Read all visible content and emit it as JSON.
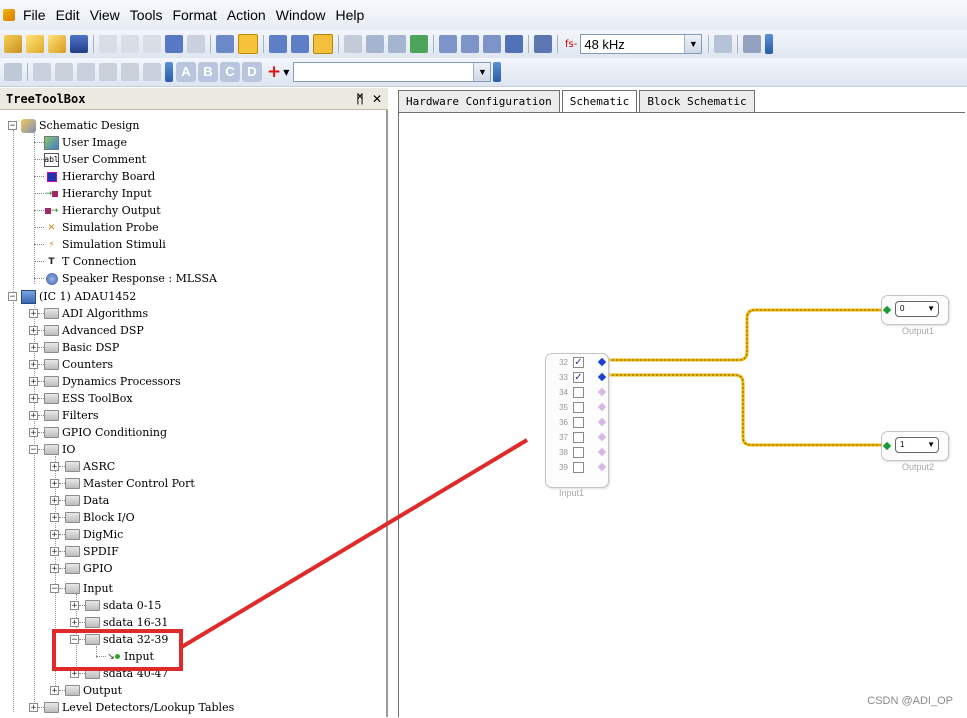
{
  "menu": [
    "File",
    "Edit",
    "View",
    "Tools",
    "Format",
    "Action",
    "Window",
    "Help"
  ],
  "toolbar": {
    "sample_rate": "48 kHz",
    "fs_label": "fs-",
    "cell_letters": [
      "A",
      "B",
      "C",
      "D"
    ],
    "add_symbol": "+"
  },
  "toolbox": {
    "title": "TreeToolBox",
    "pin": "q",
    "close": "✕"
  },
  "tree": {
    "schematic_design": "Schematic Design",
    "user_image": "User Image",
    "user_comment": "User Comment",
    "hierarchy_board": "Hierarchy Board",
    "hierarchy_input": "Hierarchy Input",
    "hierarchy_output": "Hierarchy Output",
    "simulation_probe": "Simulation Probe",
    "simulation_stimuli": "Simulation Stimuli",
    "t_connection": "T Connection",
    "speaker_response": "Speaker Response : MLSSA",
    "ic": "(IC 1) ADAU1452",
    "adi_algorithms": "ADI Algorithms",
    "advanced_dsp": "Advanced DSP",
    "basic_dsp": "Basic DSP",
    "counters": "Counters",
    "dynamics": "Dynamics Processors",
    "ess": "ESS ToolBox",
    "filters": "Filters",
    "gpio_cond": "GPIO Conditioning",
    "io": "IO",
    "asrc": "ASRC",
    "master_control": "Master Control Port",
    "data": "Data",
    "block_io": "Block I/O",
    "digmic": "DigMic",
    "spdif": "SPDIF",
    "gpio": "GPIO",
    "input": "Input",
    "sdata_0_15": "sdata 0-15",
    "sdata_16_31": "sdata 16-31",
    "sdata_32_39": "sdata 32-39",
    "input_leaf": "Input",
    "sdata_40_47": "sdata 40-47",
    "output": "Output",
    "level_detectors": "Level Detectors/Lookup Tables"
  },
  "tabs": [
    "Hardware Configuration",
    "Schematic",
    "Block Schematic"
  ],
  "schematic": {
    "input_block": {
      "label": "Input1",
      "channels": [
        "32",
        "33",
        "34",
        "35",
        "36",
        "37",
        "38",
        "39"
      ],
      "checked": [
        true,
        true,
        false,
        false,
        false,
        false,
        false,
        false
      ]
    },
    "output1": {
      "label": "Output1",
      "value": "0"
    },
    "output2": {
      "label": "Output2",
      "value": "1"
    }
  },
  "colors": {
    "wire": "#f2b600",
    "wire_dash": "#7a6400",
    "pin_blue": "#1a3fd1",
    "pin_green": "#1a9a3a",
    "highlight": "#e02a2a"
  },
  "watermark": "CSDN @ADI_OP"
}
